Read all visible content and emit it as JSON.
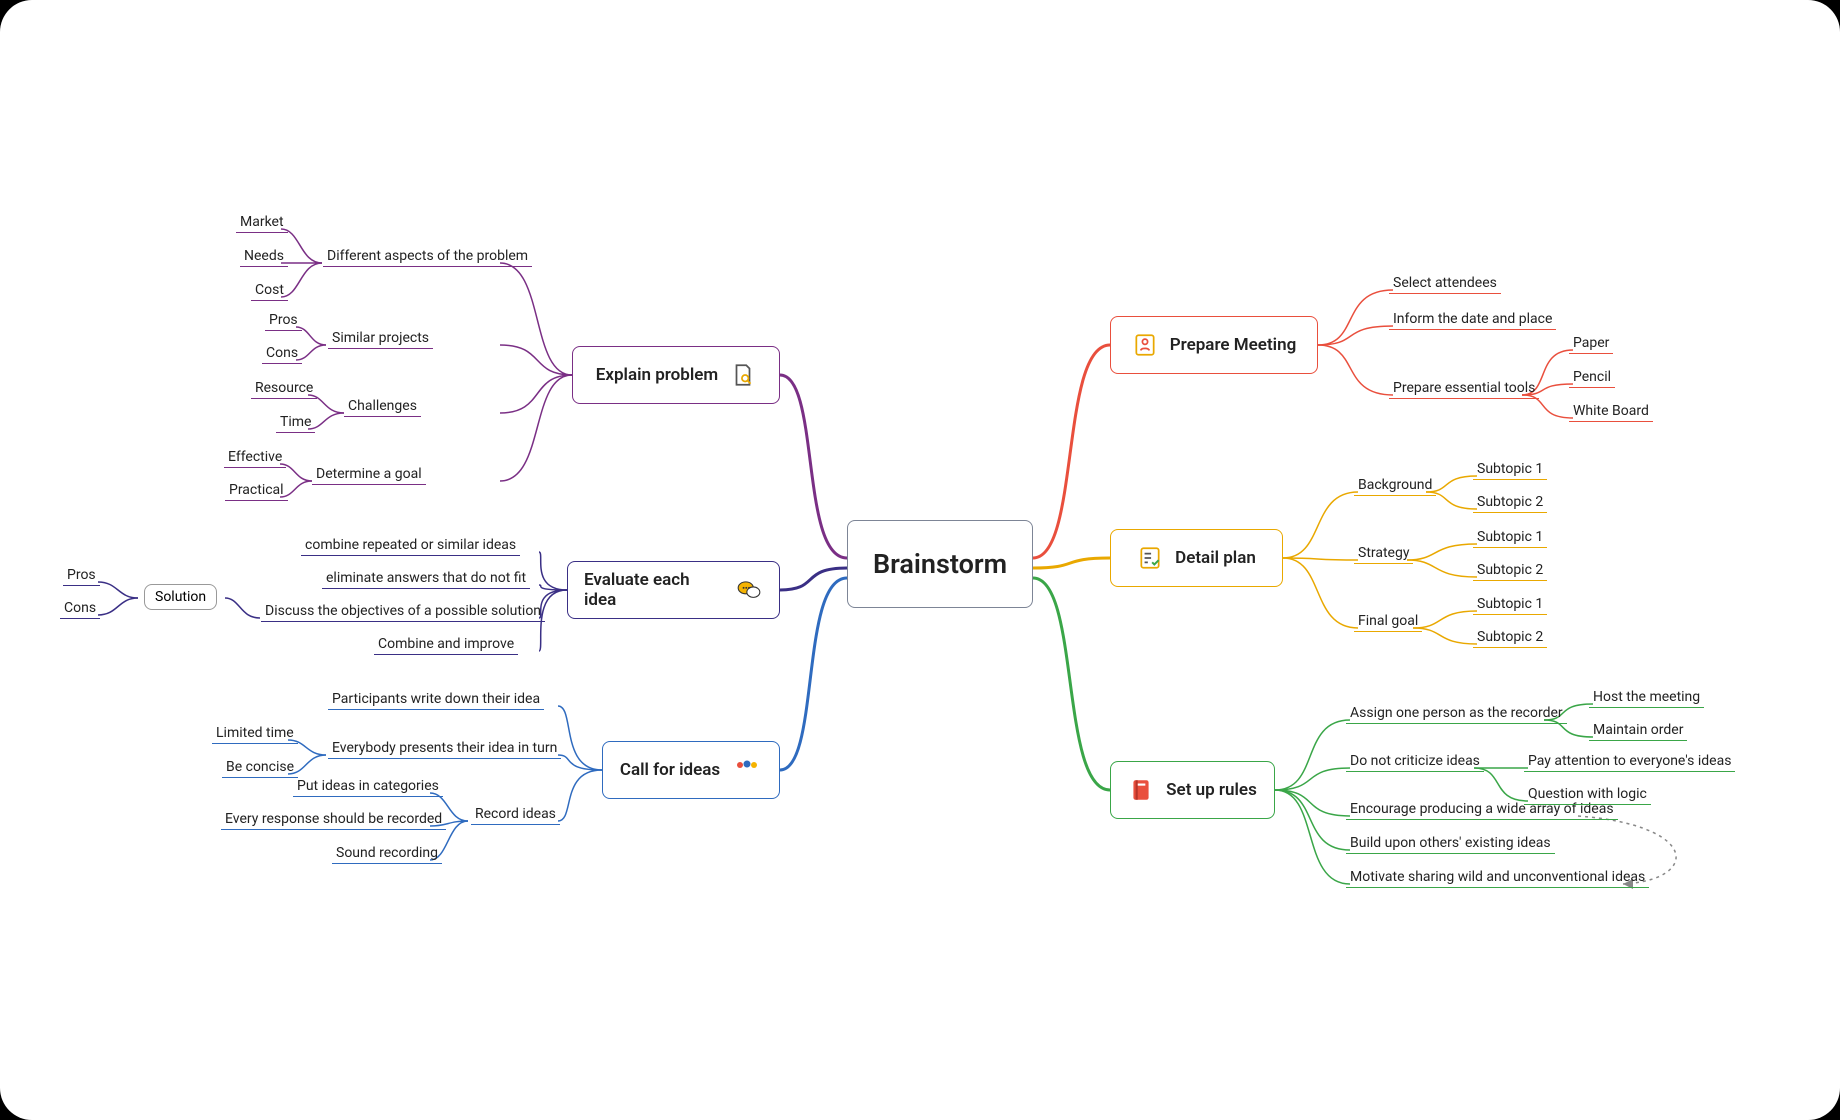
{
  "center": "Brainstorm",
  "colors": {
    "red": "#e94f3d",
    "yellow": "#e9a800",
    "green": "#3aa648",
    "purple": "#7a2f85",
    "indigo": "#3a2f85",
    "blue": "#2f6bbf"
  },
  "right": [
    {
      "id": "prepare",
      "label": "Prepare Meeting",
      "color": "red",
      "children": [
        {
          "label": "Select attendees"
        },
        {
          "label": "Inform the date and place"
        },
        {
          "label": "Prepare essential tools",
          "children": [
            {
              "label": "Paper"
            },
            {
              "label": "Pencil"
            },
            {
              "label": "White Board"
            }
          ]
        }
      ]
    },
    {
      "id": "plan",
      "label": "Detail plan",
      "color": "yellow",
      "children": [
        {
          "label": "Background",
          "children": [
            {
              "label": "Subtopic 1"
            },
            {
              "label": "Subtopic 2"
            }
          ]
        },
        {
          "label": "Strategy",
          "children": [
            {
              "label": "Subtopic 1"
            },
            {
              "label": "Subtopic 2"
            }
          ]
        },
        {
          "label": "Final goal",
          "children": [
            {
              "label": "Subtopic 1"
            },
            {
              "label": "Subtopic 2"
            }
          ]
        }
      ]
    },
    {
      "id": "rules",
      "label": "Set up rules",
      "color": "green",
      "children": [
        {
          "label": "Assign one person as the recorder",
          "children": [
            {
              "label": "Host the meeting"
            },
            {
              "label": "Maintain order"
            }
          ]
        },
        {
          "label": "Do not criticize ideas",
          "children": [
            {
              "label": "Pay attention to everyone's ideas"
            },
            {
              "label": "Question with logic"
            }
          ]
        },
        {
          "label": "Encourage producing a wide array of ideas"
        },
        {
          "label": "Build upon others' existing ideas"
        },
        {
          "label": "Motivate sharing wild and unconventional ideas"
        }
      ]
    }
  ],
  "left": [
    {
      "id": "explain",
      "label": "Explain problem",
      "color": "purple",
      "children": [
        {
          "label": "Different aspects of the problem",
          "children": [
            {
              "label": "Market"
            },
            {
              "label": "Needs"
            },
            {
              "label": "Cost"
            }
          ]
        },
        {
          "label": "Similar projects",
          "children": [
            {
              "label": "Pros"
            },
            {
              "label": "Cons"
            }
          ]
        },
        {
          "label": "Challenges",
          "children": [
            {
              "label": "Resource"
            },
            {
              "label": "Time"
            }
          ]
        },
        {
          "label": "Determine a goal",
          "children": [
            {
              "label": "Effective"
            },
            {
              "label": "Practical"
            }
          ]
        }
      ]
    },
    {
      "id": "evaluate",
      "label": "Evaluate each idea",
      "color": "indigo",
      "children": [
        {
          "label": "combine repeated or similar ideas"
        },
        {
          "label": "eliminate answers that do not fit"
        },
        {
          "label": "Discuss the objectives of a possible solution",
          "next": {
            "label": "Solution",
            "children": [
              {
                "label": "Pros"
              },
              {
                "label": "Cons"
              }
            ]
          }
        },
        {
          "label": "Combine and improve"
        }
      ]
    },
    {
      "id": "call",
      "label": "Call for ideas",
      "color": "blue",
      "children": [
        {
          "label": "Participants write down their idea"
        },
        {
          "label": "Everybody presents their idea in turn",
          "children": [
            {
              "label": "Limited time"
            },
            {
              "label": "Be concise"
            }
          ]
        },
        {
          "label": "Record ideas",
          "children": [
            {
              "label": "Put ideas in categories"
            },
            {
              "label": "Every response should be recorded"
            },
            {
              "label": "Sound recording"
            }
          ]
        }
      ]
    }
  ],
  "relation_note": "dashed relation arrow from 'Encourage producing a wide array of ideas' to 'Motivate sharing wild and unconventional ideas'"
}
